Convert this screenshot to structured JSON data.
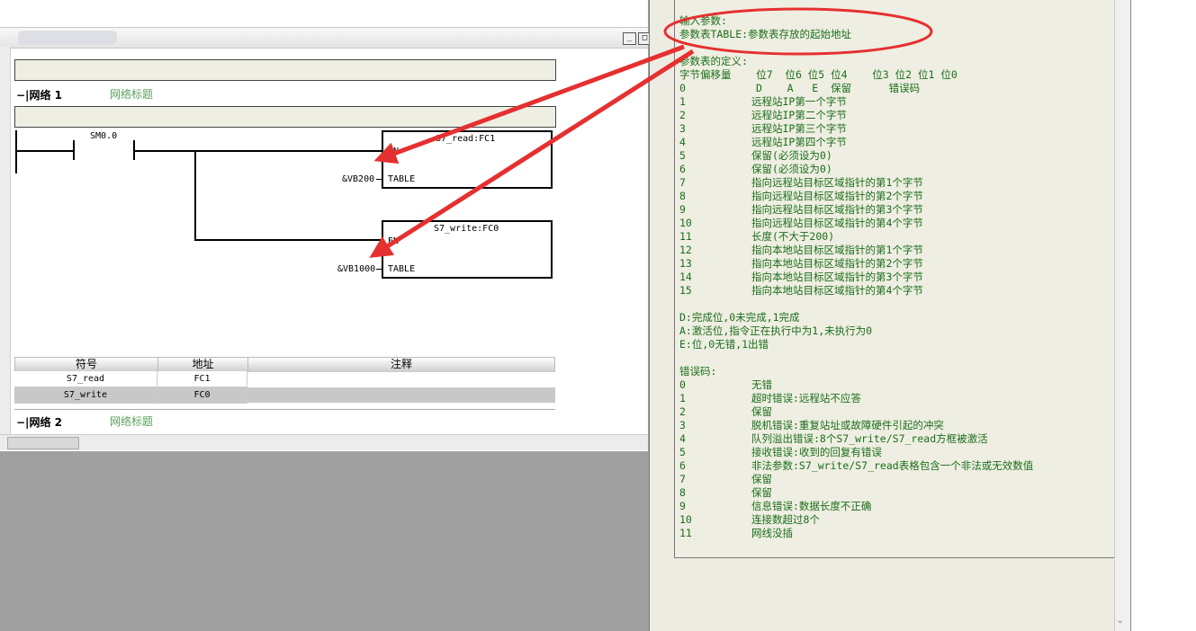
{
  "editor": {
    "networks": [
      {
        "label": "网络 1",
        "title": "网络标题"
      },
      {
        "label": "网络 2",
        "title": "网络标题"
      }
    ],
    "contact": "SM0.0",
    "blocks": [
      {
        "name": "S7_read:FC1",
        "en": "EN",
        "param": "TABLE",
        "input": "&VB200"
      },
      {
        "name": "S7_write:FC0",
        "en": "EN",
        "param": "TABLE",
        "input": "&VB1000"
      }
    ],
    "symbol_table": {
      "headers": [
        "符号",
        "地址",
        "注释"
      ],
      "rows": [
        {
          "symbol": "S7_read",
          "address": "FC1",
          "comment": ""
        },
        {
          "symbol": "S7_write",
          "address": "FC0",
          "comment": ""
        }
      ]
    },
    "window_buttons": [
      "_",
      "□"
    ]
  },
  "help": {
    "input_title": "输入参数:",
    "input_table": "参数表TABLE:参数表存放的起始地址",
    "def_title": "参数表的定义:",
    "def_header": "字节偏移量    位7  位6 位5 位4    位3 位2 位1 位0",
    "rows": [
      {
        "o": "0",
        "t": "D    A   E  保留      错误码"
      },
      {
        "o": "1",
        "t": "远程站IP第一个字节"
      },
      {
        "o": "2",
        "t": "远程站IP第二个字节"
      },
      {
        "o": "3",
        "t": "远程站IP第三个字节"
      },
      {
        "o": "4",
        "t": "远程站IP第四个字节"
      },
      {
        "o": "5",
        "t": "保留(必须设为0)"
      },
      {
        "o": "6",
        "t": "保留(必须设为0)"
      },
      {
        "o": "7",
        "t": "指向远程站目标区域指针的第1个字节"
      },
      {
        "o": "8",
        "t": "指向远程站目标区域指针的第2个字节"
      },
      {
        "o": "9",
        "t": "指向远程站目标区域指针的第3个字节"
      },
      {
        "o": "10",
        "t": "指向远程站目标区域指针的第4个字节"
      },
      {
        "o": "11",
        "t": "长度(不大于200)"
      },
      {
        "o": "12",
        "t": "指向本地站目标区域指针的第1个字节"
      },
      {
        "o": "13",
        "t": "指向本地站目标区域指针的第2个字节"
      },
      {
        "o": "14",
        "t": "指向本地站目标区域指针的第3个字节"
      },
      {
        "o": "15",
        "t": "指向本地站目标区域指针的第4个字节"
      }
    ],
    "bits": [
      "D:完成位,0未完成,1完成",
      "A:激活位,指令正在执行中为1,未执行为0",
      "E:位,0无错,1出错"
    ],
    "err_title": "错误码:",
    "errors": [
      {
        "o": "0",
        "t": "无错"
      },
      {
        "o": "1",
        "t": "超时错误:远程站不应答"
      },
      {
        "o": "2",
        "t": "保留"
      },
      {
        "o": "3",
        "t": "脱机错误:重复站址或故障硬件引起的冲突"
      },
      {
        "o": "4",
        "t": "队列溢出错误:8个S7_write/S7_read方框被激活"
      },
      {
        "o": "5",
        "t": "接收错误:收到的回复有错误"
      },
      {
        "o": "6",
        "t": "非法参数:S7_write/S7_read表格包含一个非法或无效数值"
      },
      {
        "o": "7",
        "t": "保留"
      },
      {
        "o": "8",
        "t": "保留"
      },
      {
        "o": "9",
        "t": "信息错误:数据长度不正确"
      },
      {
        "o": "10",
        "t": "连接数超过8个"
      },
      {
        "o": "11",
        "t": "网线没插"
      }
    ]
  },
  "colors": {
    "annotation": "#e53030",
    "help_text": "#1a6e1a",
    "network_title": "#5aa05a"
  }
}
